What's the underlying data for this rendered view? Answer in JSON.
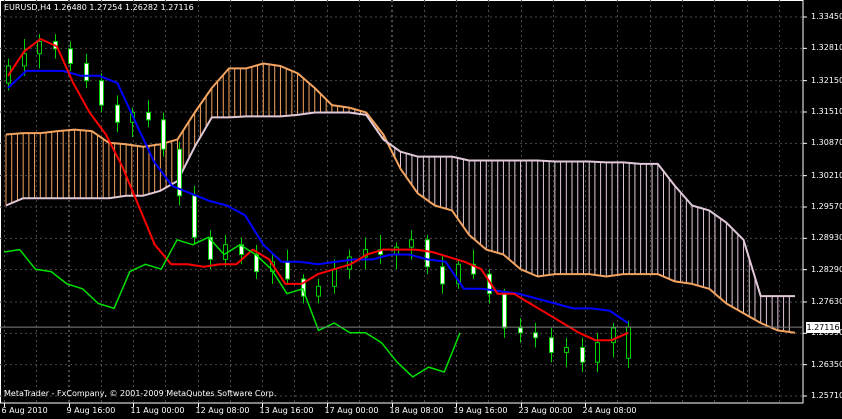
{
  "header": {
    "symbol": "EURUSD,H4",
    "ohlc": "1.26480 1.27254 1.26282 1.27116"
  },
  "copyright": "MetaTrader - FxCompany, © 2001-2009 MetaQuotes Software Corp.",
  "current_price": "1.27116",
  "colors": {
    "background": "#000000",
    "grid": "#4a4a4a",
    "candle": "#00d000",
    "tenkan": "#ff0000",
    "kijun": "#0000ff",
    "chikou": "#00e000",
    "senkou_a": "#f4a460",
    "senkou_b": "#e0c8d8"
  },
  "chart_data": {
    "type": "line",
    "title": "",
    "ylim": [
      1.2571,
      1.3345
    ],
    "y_ticks": [
      "1.33450",
      "1.32810",
      "1.32150",
      "1.31510",
      "1.30870",
      "1.30210",
      "1.29570",
      "1.28930",
      "1.28290",
      "1.27630",
      "1.26990",
      "1.26350",
      "1.25710"
    ],
    "x_ticks": [
      "6 Aug 2010",
      "9 Aug 16:00",
      "11 Aug 00:00",
      "12 Aug 08:00",
      "13 Aug 16:00",
      "17 Aug 00:00",
      "18 Aug 08:00",
      "19 Aug 16:00",
      "23 Aug 00:00",
      "24 Aug 08:00"
    ],
    "series": [
      {
        "key": "senkou_a",
        "values": [
          1.3105,
          1.3108,
          1.3108,
          1.3112,
          1.3115,
          1.3112,
          1.3088,
          1.3085,
          1.308,
          1.3085,
          1.3095,
          1.315,
          1.32,
          1.324,
          1.324,
          1.325,
          1.3245,
          1.323,
          1.32,
          1.3165,
          1.316,
          1.315,
          1.3105,
          1.3035,
          1.2985,
          1.296,
          1.295,
          1.29,
          1.287,
          1.286,
          1.283,
          1.2815,
          1.282,
          1.282,
          1.282,
          1.2815,
          1.282,
          1.282,
          1.282,
          1.2805,
          1.28,
          1.279,
          1.276,
          1.274,
          1.272,
          1.2705,
          1.27
        ]
      },
      {
        "key": "senkou_b",
        "values": [
          1.296,
          1.2975,
          1.2975,
          1.2975,
          1.2975,
          1.2975,
          1.2975,
          1.298,
          1.298,
          1.299,
          1.301,
          1.308,
          1.314,
          1.314,
          1.3142,
          1.3142,
          1.3142,
          1.3145,
          1.315,
          1.315,
          1.315,
          1.3145,
          1.3095,
          1.307,
          1.306,
          1.306,
          1.306,
          1.3052,
          1.3052,
          1.3052,
          1.3052,
          1.3052,
          1.305,
          1.305,
          1.305,
          1.3048,
          1.3048,
          1.3045,
          1.3045,
          1.3,
          1.296,
          1.295,
          1.2925,
          1.289,
          1.2775,
          1.2775,
          1.2775
        ]
      },
      {
        "key": "tenkan",
        "values": [
          1.3225,
          1.3275,
          1.33,
          1.3285,
          1.321,
          1.315,
          1.3105,
          1.304,
          1.296,
          1.288,
          1.284,
          1.284,
          1.2835,
          1.284,
          1.284,
          1.287,
          1.285,
          1.28,
          1.28,
          1.282,
          1.283,
          1.284,
          1.286,
          1.287,
          1.287,
          1.287,
          1.2865,
          1.2855,
          1.2845,
          1.283,
          1.278,
          1.278,
          1.276,
          1.274,
          1.272,
          1.27,
          1.2685,
          1.2685,
          1.27
        ]
      },
      {
        "key": "kijun",
        "values": [
          1.32,
          1.3235,
          1.3235,
          1.3235,
          1.3225,
          1.3225,
          1.321,
          1.313,
          1.305,
          1.3,
          1.2985,
          1.297,
          1.296,
          1.294,
          1.288,
          1.2845,
          1.2845,
          1.284,
          1.2845,
          1.285,
          1.285,
          1.286,
          1.286,
          1.285,
          1.2845,
          1.279,
          1.279,
          1.2785,
          1.278,
          1.277,
          1.276,
          1.275,
          1.275,
          1.2745,
          1.272
        ]
      },
      {
        "key": "chikou",
        "values": [
          1.2865,
          1.287,
          1.283,
          1.2825,
          1.28,
          1.279,
          1.276,
          1.275,
          1.2825,
          1.284,
          1.283,
          1.289,
          1.288,
          1.2895,
          1.286,
          1.288,
          1.286,
          1.283,
          1.278,
          1.279,
          1.2705,
          1.272,
          1.27,
          1.27,
          1.268,
          1.264,
          1.261,
          1.263,
          1.262,
          1.27
        ]
      }
    ],
    "candles": [
      [
        1.321,
        1.326,
        1.3195,
        1.3245
      ],
      [
        1.3245,
        1.33,
        1.3225,
        1.327
      ],
      [
        1.327,
        1.331,
        1.324,
        1.3295
      ],
      [
        1.3295,
        1.331,
        1.326,
        1.328
      ],
      [
        1.328,
        1.3295,
        1.3235,
        1.325
      ],
      [
        1.325,
        1.327,
        1.32,
        1.3215
      ],
      [
        1.3215,
        1.323,
        1.315,
        1.3165
      ],
      [
        1.3165,
        1.3185,
        1.311,
        1.313
      ],
      [
        1.313,
        1.316,
        1.31,
        1.315
      ],
      [
        1.315,
        1.3175,
        1.312,
        1.3135
      ],
      [
        1.3135,
        1.315,
        1.306,
        1.3075
      ],
      [
        1.3075,
        1.309,
        1.296,
        1.298
      ],
      [
        1.298,
        1.3,
        1.288,
        1.2895
      ],
      [
        1.2895,
        1.291,
        1.283,
        1.285
      ],
      [
        1.285,
        1.29,
        1.2835,
        1.288
      ],
      [
        1.288,
        1.2895,
        1.284,
        1.286
      ],
      [
        1.286,
        1.288,
        1.281,
        1.2825
      ],
      [
        1.2825,
        1.286,
        1.28,
        1.2845
      ],
      [
        1.2845,
        1.287,
        1.28,
        1.281
      ],
      [
        1.281,
        1.282,
        1.276,
        1.2775
      ],
      [
        1.2775,
        1.281,
        1.276,
        1.2795
      ],
      [
        1.2795,
        1.285,
        1.278,
        1.283
      ],
      [
        1.283,
        1.287,
        1.281,
        1.2855
      ],
      [
        1.2855,
        1.2895,
        1.283,
        1.287
      ],
      [
        1.287,
        1.29,
        1.284,
        1.286
      ],
      [
        1.286,
        1.2885,
        1.283,
        1.2875
      ],
      [
        1.2875,
        1.291,
        1.285,
        1.289
      ],
      [
        1.289,
        1.29,
        1.282,
        1.2835
      ],
      [
        1.2835,
        1.286,
        1.278,
        1.28
      ],
      [
        1.28,
        1.285,
        1.279,
        1.284
      ],
      [
        1.284,
        1.287,
        1.281,
        1.282
      ],
      [
        1.282,
        1.283,
        1.276,
        1.278
      ],
      [
        1.278,
        1.279,
        1.269,
        1.271
      ],
      [
        1.271,
        1.273,
        1.268,
        1.27
      ],
      [
        1.27,
        1.272,
        1.267,
        1.269
      ],
      [
        1.269,
        1.271,
        1.264,
        1.266
      ],
      [
        1.266,
        1.269,
        1.263,
        1.267
      ],
      [
        1.267,
        1.269,
        1.262,
        1.264
      ],
      [
        1.264,
        1.27,
        1.262,
        1.268
      ],
      [
        1.268,
        1.272,
        1.265,
        1.271
      ],
      [
        1.2648,
        1.2725,
        1.2628,
        1.2712
      ]
    ]
  }
}
